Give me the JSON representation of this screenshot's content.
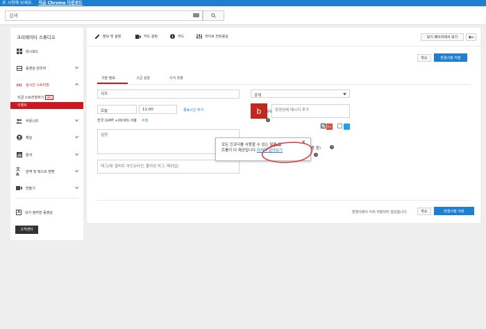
{
  "banner": {
    "text": "로 시청해 보세요.",
    "link": "지금 Chrome 다운로드"
  },
  "search": {
    "placeholder": "검색"
  },
  "sidebar": {
    "title": "크리에이터 스튜디오",
    "items": [
      {
        "label": "대시보드"
      },
      {
        "label": "동영상 관리자"
      },
      {
        "label": "실시간 스트리밍"
      },
      {
        "label": "커뮤니티"
      },
      {
        "label": "채널"
      },
      {
        "label": "분석"
      },
      {
        "label": "번역 및 텍스트 변환"
      },
      {
        "label": "만들기"
      },
      {
        "label": "내가 참여한 동영상"
      }
    ],
    "sub_stream_now": "지금 스트리밍하기",
    "beta_badge": "베타",
    "sub_events": "이벤트",
    "help_button": "고객센터"
  },
  "toolbar": {
    "info_settings": "정보 및 설정",
    "cards_setup": "카드 설정",
    "cards": "카드",
    "live_control": "라이브 컨트롤실",
    "view_on_watch_page": "보기 페이지에서 보기",
    "back_icon": "back-arrow-icon"
  },
  "actions": {
    "cancel": "취소",
    "save": "변경사항 저장",
    "unsaved_note": "변경사항이 아직 저장되지 않았습니다."
  },
  "tabs": [
    "기본 정보",
    "고급 설정",
    "수익 창출"
  ],
  "form": {
    "title_placeholder": "제목",
    "date": "오늘",
    "time": "11:00",
    "add_end_time": "종료시간 추가",
    "timezone": "한국 (GMT +09:00) 서울",
    "edit": "수정",
    "description_placeholder": "설명",
    "tags_placeholder": "태그(예: 알버트 아인슈타인, 플라잉 피그, 매쉬업)",
    "privacy": "공개",
    "share_label": "공유",
    "share_placeholder": "동영상에 메시지 추가",
    "red_badge": "b",
    "popup_tail_text": "사용 중)"
  },
  "popup": {
    "line1": "모든 인코더를 사용할 수 있는 맞춤 컨",
    "line2": "트롤이 더 제공됩니다.",
    "link": "자세히 알아보기"
  },
  "colors": {
    "brand_blue": "#1e7fd0",
    "active_red": "#cc181e"
  }
}
